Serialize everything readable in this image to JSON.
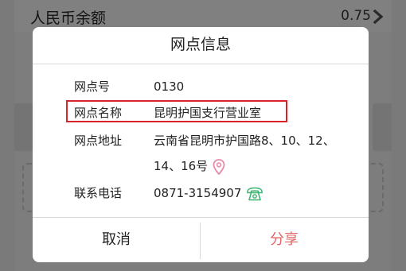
{
  "background": {
    "balance_label": "人民币余额",
    "balance_value": "0.75"
  },
  "dialog": {
    "title": "网点信息",
    "rows": [
      {
        "label": "网点号",
        "value": "0130"
      },
      {
        "label": "网点名称",
        "value": "昆明护国支行营业室"
      },
      {
        "label": "网点地址",
        "value": "云南省昆明市护国路8、10、12、",
        "value_line2": "14、16号"
      },
      {
        "label": "联系电话",
        "value": "0871-3154907"
      }
    ],
    "cancel_label": "取消",
    "share_label": "分享"
  },
  "icons": {
    "address": "map-pin-icon",
    "phone": "telephone-icon",
    "chevron": "chevron-right-icon"
  },
  "colors": {
    "highlight": "#d9232a",
    "share": "#e06666",
    "pin": "#e68aa8",
    "phone": "#3cb371"
  }
}
